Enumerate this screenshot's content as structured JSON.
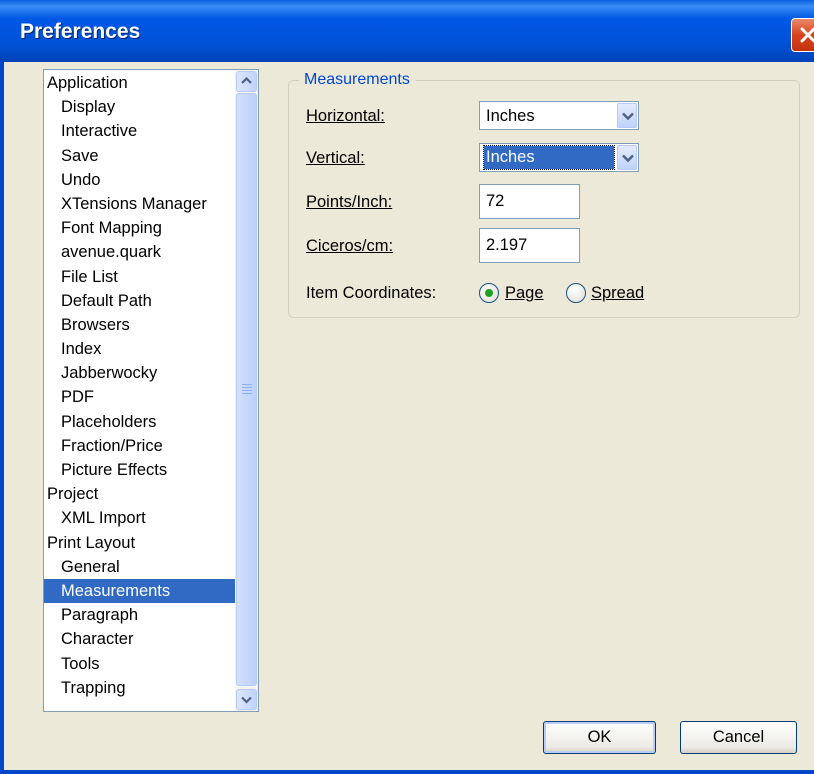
{
  "window": {
    "title": "Preferences"
  },
  "sidebar": {
    "items": [
      {
        "label": "Application",
        "level": 0
      },
      {
        "label": "Display",
        "level": 1
      },
      {
        "label": "Interactive",
        "level": 1
      },
      {
        "label": "Save",
        "level": 1
      },
      {
        "label": "Undo",
        "level": 1
      },
      {
        "label": "XTensions Manager",
        "level": 1
      },
      {
        "label": "Font Mapping",
        "level": 1
      },
      {
        "label": "avenue.quark",
        "level": 1
      },
      {
        "label": "File List",
        "level": 1
      },
      {
        "label": "Default Path",
        "level": 1
      },
      {
        "label": "Browsers",
        "level": 1
      },
      {
        "label": "Index",
        "level": 1
      },
      {
        "label": "Jabberwocky",
        "level": 1
      },
      {
        "label": "PDF",
        "level": 1
      },
      {
        "label": "Placeholders",
        "level": 1
      },
      {
        "label": "Fraction/Price",
        "level": 1
      },
      {
        "label": "Picture Effects",
        "level": 1
      },
      {
        "label": "Project",
        "level": 0
      },
      {
        "label": "XML Import",
        "level": 1
      },
      {
        "label": "Print Layout",
        "level": 0
      },
      {
        "label": "General",
        "level": 1
      },
      {
        "label": "Measurements",
        "level": 1,
        "selected": true
      },
      {
        "label": "Paragraph",
        "level": 1
      },
      {
        "label": "Character",
        "level": 1
      },
      {
        "label": "Tools",
        "level": 1
      },
      {
        "label": "Trapping",
        "level": 1
      }
    ]
  },
  "measurements": {
    "group_title": "Measurements",
    "horizontal_label": "Horizontal:",
    "horizontal_value": "Inches",
    "vertical_label": "Vertical:",
    "vertical_value": "Inches",
    "points_inch_label": "Points/Inch:",
    "points_inch_value": "72",
    "ciceros_cm_label": "Ciceros/cm:",
    "ciceros_cm_value": "2.197",
    "item_coordinates_label": "Item Coordinates:",
    "radio_page_label": "Page",
    "radio_spread_label": "Spread",
    "selected_coordinate": "Page"
  },
  "buttons": {
    "ok": "OK",
    "cancel": "Cancel"
  },
  "colors": {
    "titlebar": "#0058e6",
    "selection": "#316ac5",
    "group_title": "#0046d5",
    "radio_dot": "#21a121"
  }
}
